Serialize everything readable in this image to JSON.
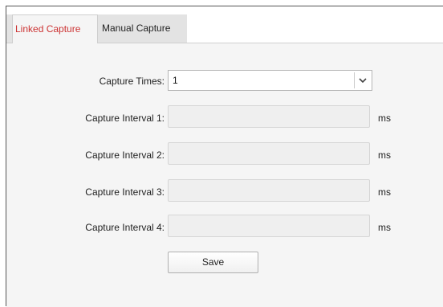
{
  "tabs": [
    {
      "label": "Linked Capture",
      "active": true
    },
    {
      "label": "Manual Capture",
      "active": false
    }
  ],
  "form": {
    "capture_times": {
      "label": "Capture Times:",
      "value": "1",
      "icon": "chevron-down-icon"
    },
    "intervals": [
      {
        "label": "Capture Interval 1:",
        "value": "",
        "unit": "ms",
        "disabled": true
      },
      {
        "label": "Capture Interval 2:",
        "value": "",
        "unit": "ms",
        "disabled": true
      },
      {
        "label": "Capture Interval 3:",
        "value": "",
        "unit": "ms",
        "disabled": true
      },
      {
        "label": "Capture Interval 4:",
        "value": "",
        "unit": "ms",
        "disabled": true
      }
    ],
    "save_label": "Save"
  },
  "colors": {
    "active_tab_text": "#cc3333",
    "panel_background": "#f5f5f5",
    "disabled_field": "#efefef"
  }
}
